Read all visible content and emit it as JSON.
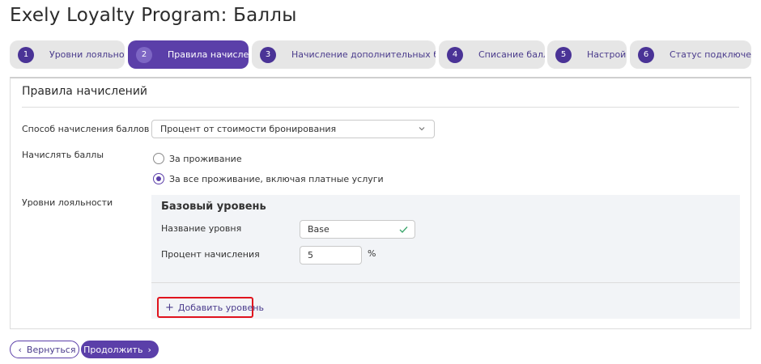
{
  "page": {
    "title": "Exely Loyalty Program: Баллы"
  },
  "tabs": [
    {
      "num": "1",
      "label": "Уровни лояльности",
      "active": false
    },
    {
      "num": "2",
      "label": "Правила начислений",
      "active": true
    },
    {
      "num": "3",
      "label": "Начисление дополнительных баллов",
      "active": false
    },
    {
      "num": "4",
      "label": "Списание баллов",
      "active": false
    },
    {
      "num": "5",
      "label": "Настройки",
      "active": false
    },
    {
      "num": "6",
      "label": "Статус подключения",
      "active": false
    }
  ],
  "section": {
    "title": "Правила начислений"
  },
  "accrual_method": {
    "label": "Способ начисления баллов",
    "value": "Процент от стоимости бронирования",
    "icon": "chevron-down-icon"
  },
  "accrue_points": {
    "label": "Начислять баллы",
    "options": [
      {
        "label": "За проживание",
        "checked": false
      },
      {
        "label": "За все проживание, включая платные услуги",
        "checked": true
      }
    ]
  },
  "loyalty_levels": {
    "label": "Уровни лояльности",
    "level": {
      "title": "Базовый уровень",
      "name_label": "Название уровня",
      "name_value": "Base",
      "percent_label": "Процент начисления",
      "percent_value": "5",
      "percent_unit": "%"
    },
    "add_button": {
      "icon": "+",
      "label": "Добавить уровень"
    }
  },
  "footer": {
    "back": {
      "icon": "‹",
      "label": "Вернуться"
    },
    "next": {
      "label": "Продолжить",
      "icon": "›"
    }
  },
  "colors": {
    "accent": "#5b3fa9",
    "accent_text": "#4a3b8c",
    "tab_bg": "#e6e6e6",
    "levels_bg": "#f2f4f7",
    "highlight": "#e0141e",
    "valid": "#3aa66b"
  }
}
